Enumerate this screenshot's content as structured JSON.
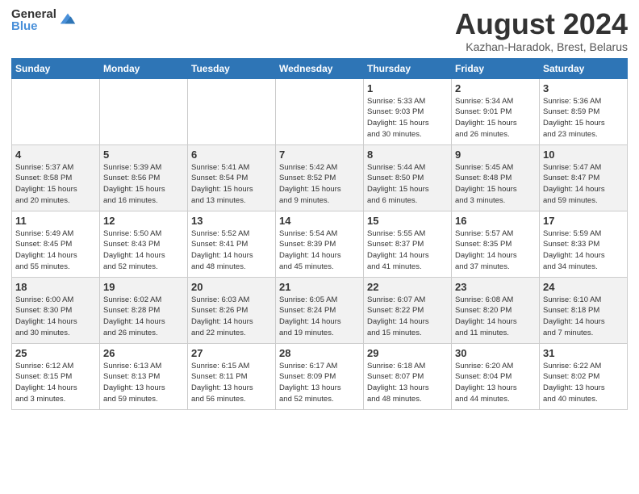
{
  "header": {
    "logo_general": "General",
    "logo_blue": "Blue",
    "month_title": "August 2024",
    "subtitle": "Kazhan-Haradok, Brest, Belarus"
  },
  "weekdays": [
    "Sunday",
    "Monday",
    "Tuesday",
    "Wednesday",
    "Thursday",
    "Friday",
    "Saturday"
  ],
  "rows": [
    [
      {
        "num": "",
        "info": ""
      },
      {
        "num": "",
        "info": ""
      },
      {
        "num": "",
        "info": ""
      },
      {
        "num": "",
        "info": ""
      },
      {
        "num": "1",
        "info": "Sunrise: 5:33 AM\nSunset: 9:03 PM\nDaylight: 15 hours\nand 30 minutes."
      },
      {
        "num": "2",
        "info": "Sunrise: 5:34 AM\nSunset: 9:01 PM\nDaylight: 15 hours\nand 26 minutes."
      },
      {
        "num": "3",
        "info": "Sunrise: 5:36 AM\nSunset: 8:59 PM\nDaylight: 15 hours\nand 23 minutes."
      }
    ],
    [
      {
        "num": "4",
        "info": "Sunrise: 5:37 AM\nSunset: 8:58 PM\nDaylight: 15 hours\nand 20 minutes."
      },
      {
        "num": "5",
        "info": "Sunrise: 5:39 AM\nSunset: 8:56 PM\nDaylight: 15 hours\nand 16 minutes."
      },
      {
        "num": "6",
        "info": "Sunrise: 5:41 AM\nSunset: 8:54 PM\nDaylight: 15 hours\nand 13 minutes."
      },
      {
        "num": "7",
        "info": "Sunrise: 5:42 AM\nSunset: 8:52 PM\nDaylight: 15 hours\nand 9 minutes."
      },
      {
        "num": "8",
        "info": "Sunrise: 5:44 AM\nSunset: 8:50 PM\nDaylight: 15 hours\nand 6 minutes."
      },
      {
        "num": "9",
        "info": "Sunrise: 5:45 AM\nSunset: 8:48 PM\nDaylight: 15 hours\nand 3 minutes."
      },
      {
        "num": "10",
        "info": "Sunrise: 5:47 AM\nSunset: 8:47 PM\nDaylight: 14 hours\nand 59 minutes."
      }
    ],
    [
      {
        "num": "11",
        "info": "Sunrise: 5:49 AM\nSunset: 8:45 PM\nDaylight: 14 hours\nand 55 minutes."
      },
      {
        "num": "12",
        "info": "Sunrise: 5:50 AM\nSunset: 8:43 PM\nDaylight: 14 hours\nand 52 minutes."
      },
      {
        "num": "13",
        "info": "Sunrise: 5:52 AM\nSunset: 8:41 PM\nDaylight: 14 hours\nand 48 minutes."
      },
      {
        "num": "14",
        "info": "Sunrise: 5:54 AM\nSunset: 8:39 PM\nDaylight: 14 hours\nand 45 minutes."
      },
      {
        "num": "15",
        "info": "Sunrise: 5:55 AM\nSunset: 8:37 PM\nDaylight: 14 hours\nand 41 minutes."
      },
      {
        "num": "16",
        "info": "Sunrise: 5:57 AM\nSunset: 8:35 PM\nDaylight: 14 hours\nand 37 minutes."
      },
      {
        "num": "17",
        "info": "Sunrise: 5:59 AM\nSunset: 8:33 PM\nDaylight: 14 hours\nand 34 minutes."
      }
    ],
    [
      {
        "num": "18",
        "info": "Sunrise: 6:00 AM\nSunset: 8:30 PM\nDaylight: 14 hours\nand 30 minutes."
      },
      {
        "num": "19",
        "info": "Sunrise: 6:02 AM\nSunset: 8:28 PM\nDaylight: 14 hours\nand 26 minutes."
      },
      {
        "num": "20",
        "info": "Sunrise: 6:03 AM\nSunset: 8:26 PM\nDaylight: 14 hours\nand 22 minutes."
      },
      {
        "num": "21",
        "info": "Sunrise: 6:05 AM\nSunset: 8:24 PM\nDaylight: 14 hours\nand 19 minutes."
      },
      {
        "num": "22",
        "info": "Sunrise: 6:07 AM\nSunset: 8:22 PM\nDaylight: 14 hours\nand 15 minutes."
      },
      {
        "num": "23",
        "info": "Sunrise: 6:08 AM\nSunset: 8:20 PM\nDaylight: 14 hours\nand 11 minutes."
      },
      {
        "num": "24",
        "info": "Sunrise: 6:10 AM\nSunset: 8:18 PM\nDaylight: 14 hours\nand 7 minutes."
      }
    ],
    [
      {
        "num": "25",
        "info": "Sunrise: 6:12 AM\nSunset: 8:15 PM\nDaylight: 14 hours\nand 3 minutes."
      },
      {
        "num": "26",
        "info": "Sunrise: 6:13 AM\nSunset: 8:13 PM\nDaylight: 13 hours\nand 59 minutes."
      },
      {
        "num": "27",
        "info": "Sunrise: 6:15 AM\nSunset: 8:11 PM\nDaylight: 13 hours\nand 56 minutes."
      },
      {
        "num": "28",
        "info": "Sunrise: 6:17 AM\nSunset: 8:09 PM\nDaylight: 13 hours\nand 52 minutes."
      },
      {
        "num": "29",
        "info": "Sunrise: 6:18 AM\nSunset: 8:07 PM\nDaylight: 13 hours\nand 48 minutes."
      },
      {
        "num": "30",
        "info": "Sunrise: 6:20 AM\nSunset: 8:04 PM\nDaylight: 13 hours\nand 44 minutes."
      },
      {
        "num": "31",
        "info": "Sunrise: 6:22 AM\nSunset: 8:02 PM\nDaylight: 13 hours\nand 40 minutes."
      }
    ]
  ]
}
